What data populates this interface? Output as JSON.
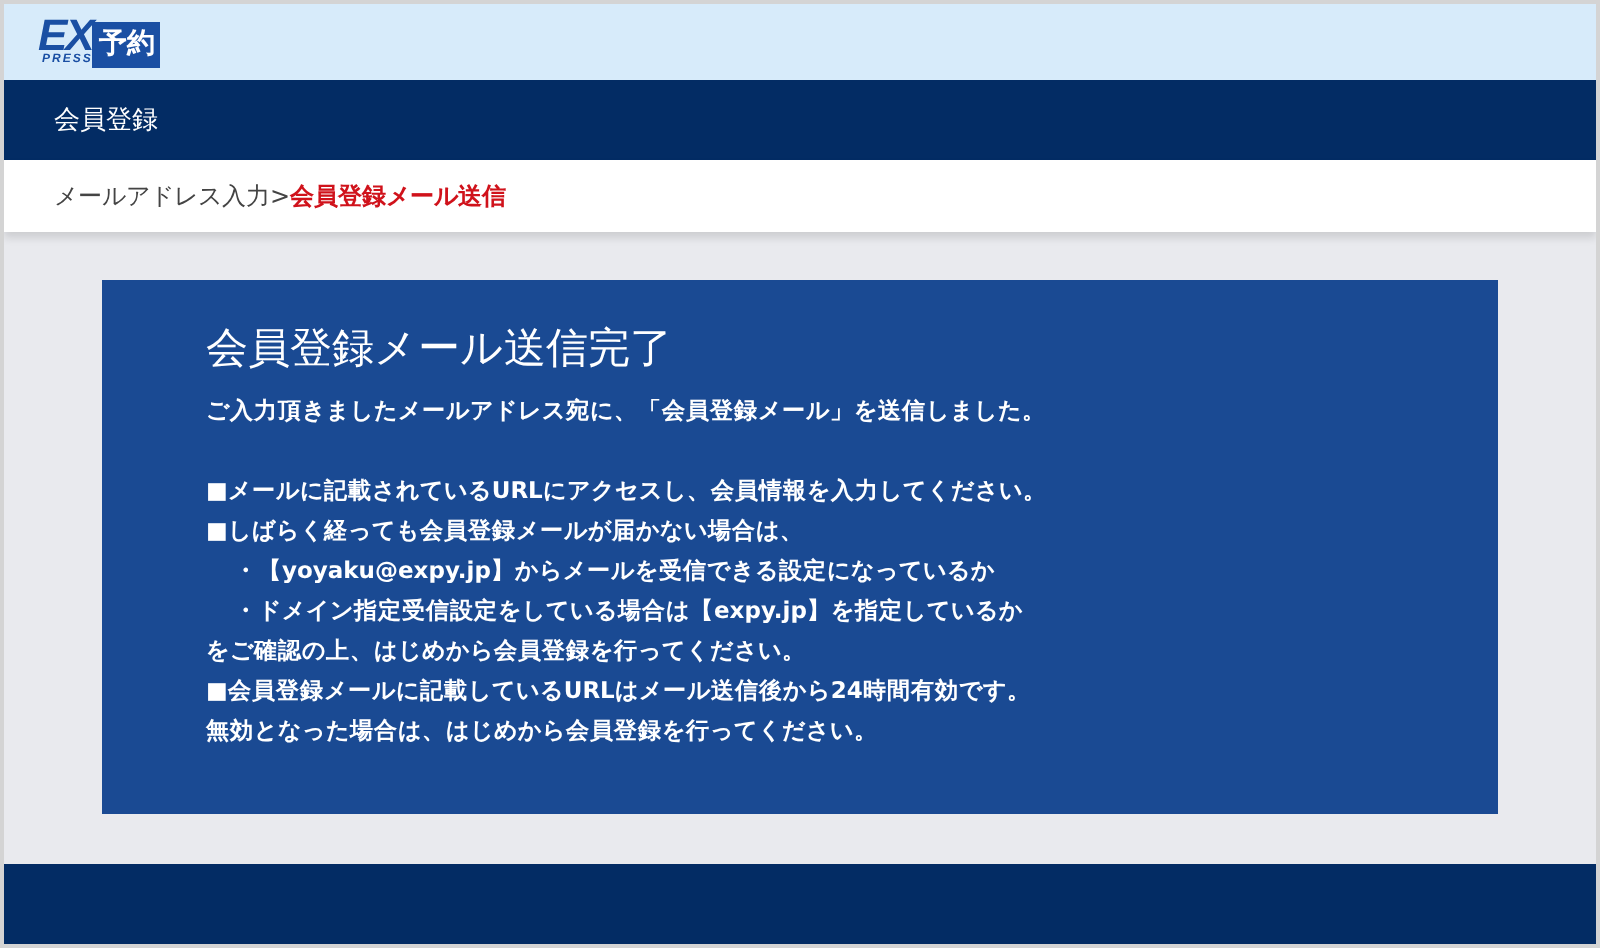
{
  "logo": {
    "main": "EX",
    "sub": "PRESS",
    "badge": "予約"
  },
  "nav": {
    "title": "会員登録"
  },
  "breadcrumb": [
    {
      "label": "メールアドレス入力",
      "current": false
    },
    {
      "label": "会員登録メール送信",
      "current": true
    }
  ],
  "breadcrumb_separator": ">",
  "message": {
    "title": "会員登録メール送信完了",
    "lead": "ご入力頂きましたメールアドレス宛に、「会員登録メール」を送信しました。",
    "lines": [
      {
        "kind": "bullet",
        "text": "■メールに記載されているURLにアクセスし、会員情報を入力してください。"
      },
      {
        "kind": "bullet",
        "text": "■しばらく経っても会員登録メールが届かない場合は、"
      },
      {
        "kind": "sub",
        "text": "・【yoyaku@expy.jp】からメールを受信できる設定になっているか"
      },
      {
        "kind": "sub",
        "text": "・ドメイン指定受信設定をしている場合は【expy.jp】を指定しているか"
      },
      {
        "kind": "bullet",
        "text": "をご確認の上、はじめから会員登録を行ってください。"
      },
      {
        "kind": "bullet",
        "text": "■会員登録メールに記載しているURLはメール送信後から24時間有効です。"
      },
      {
        "kind": "bullet",
        "text": "無効となった場合は、はじめから会員登録を行ってください。"
      }
    ]
  }
}
